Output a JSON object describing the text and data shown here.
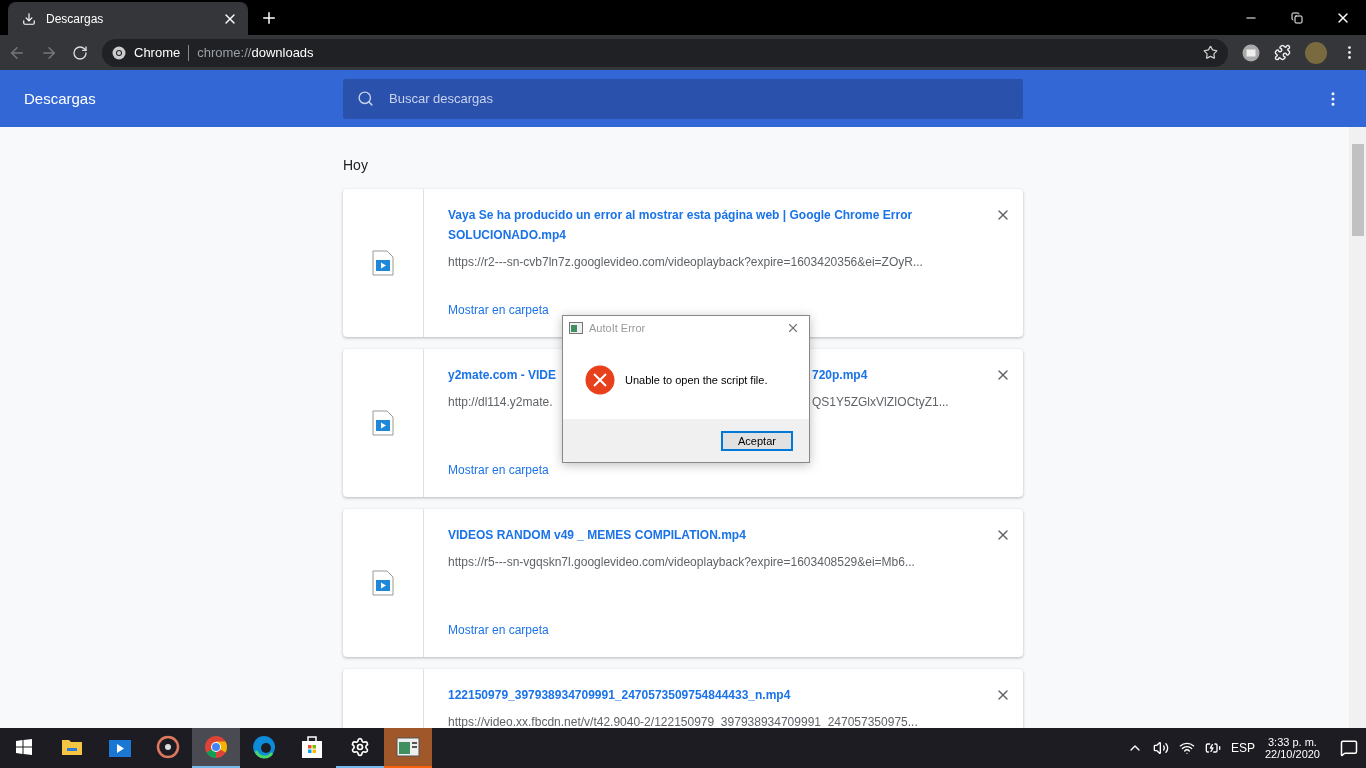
{
  "tab": {
    "title": "Descargas",
    "selected": true
  },
  "omnibox": {
    "site": "Chrome",
    "scheme": "chrome://",
    "path": "downloads"
  },
  "header": {
    "title": "Descargas",
    "search_placeholder": "Buscar descargas"
  },
  "section_label": "Hoy",
  "downloads": [
    {
      "title_parts": [
        "Vaya Se ha producido un error al mostrar esta página web | Google Chrome Error SOLUCIONADO.mp4"
      ],
      "url_parts": [
        "https://r2---sn-cvb7ln7z.googlevideo.com/videoplayback?expire=1603420356&ei=ZOyR..."
      ],
      "action": "Mostrar en carpeta"
    },
    {
      "title_parts": [
        "y2mate.com - VIDE",
        "720p.mp4"
      ],
      "url_parts": [
        "http://dl114.y2mate.",
        "QS1Y5ZGlxVlZIOCtyZ1..."
      ],
      "action": "Mostrar en carpeta"
    },
    {
      "title_parts": [
        "VIDEOS RANDOM v49 _ MEMES COMPILATION.mp4"
      ],
      "url_parts": [
        "https://r5---sn-vgqskn7l.googlevideo.com/videoplayback?expire=1603408529&ei=Mb6..."
      ],
      "action": "Mostrar en carpeta"
    },
    {
      "title_parts": [
        "122150979_397938934709991_2470573509754844433_n.mp4"
      ],
      "url_parts": [
        "https://video.xx.fbcdn.net/v/t42.9040-2/122150979_397938934709991_247057350975..."
      ]
    }
  ],
  "dialog": {
    "title": "AutoIt Error",
    "message": "Unable to open the script file.",
    "button": "Aceptar"
  },
  "taskbar": {
    "apps": [
      {
        "kind": "explorer",
        "open": false,
        "selected": false
      },
      {
        "kind": "video",
        "open": false,
        "selected": false
      },
      {
        "kind": "music",
        "open": false,
        "selected": false
      },
      {
        "kind": "chrome",
        "open": true,
        "selected": true
      },
      {
        "kind": "edge",
        "open": false,
        "selected": false
      },
      {
        "kind": "store",
        "open": false,
        "selected": false
      },
      {
        "kind": "settings",
        "open": true,
        "selected": false
      },
      {
        "kind": "autoit",
        "open": true,
        "selected": false,
        "flashing": true
      }
    ],
    "language": "ESP",
    "time": "3:33 p. m.",
    "date": "22/10/2020"
  }
}
